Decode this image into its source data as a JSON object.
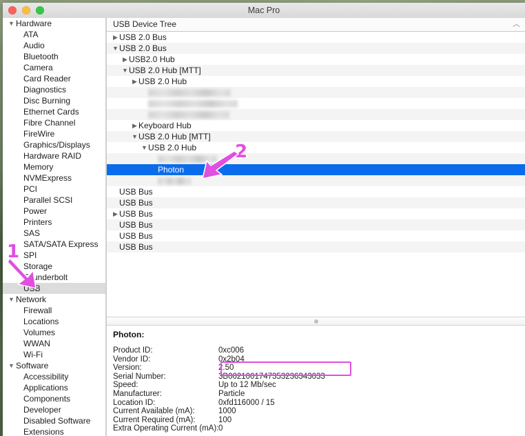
{
  "window": {
    "title": "Mac Pro",
    "traffic_lights": [
      "close-button",
      "minimize-button",
      "maximize-button"
    ]
  },
  "sidebar": {
    "items": [
      {
        "label": "Hardware",
        "level": 0,
        "disclosure": "▼",
        "selected": false
      },
      {
        "label": "ATA",
        "level": 1,
        "disclosure": "",
        "selected": false
      },
      {
        "label": "Audio",
        "level": 1,
        "disclosure": "",
        "selected": false
      },
      {
        "label": "Bluetooth",
        "level": 1,
        "disclosure": "",
        "selected": false
      },
      {
        "label": "Camera",
        "level": 1,
        "disclosure": "",
        "selected": false
      },
      {
        "label": "Card Reader",
        "level": 1,
        "disclosure": "",
        "selected": false
      },
      {
        "label": "Diagnostics",
        "level": 1,
        "disclosure": "",
        "selected": false
      },
      {
        "label": "Disc Burning",
        "level": 1,
        "disclosure": "",
        "selected": false
      },
      {
        "label": "Ethernet Cards",
        "level": 1,
        "disclosure": "",
        "selected": false
      },
      {
        "label": "Fibre Channel",
        "level": 1,
        "disclosure": "",
        "selected": false
      },
      {
        "label": "FireWire",
        "level": 1,
        "disclosure": "",
        "selected": false
      },
      {
        "label": "Graphics/Displays",
        "level": 1,
        "disclosure": "",
        "selected": false
      },
      {
        "label": "Hardware RAID",
        "level": 1,
        "disclosure": "",
        "selected": false
      },
      {
        "label": "Memory",
        "level": 1,
        "disclosure": "",
        "selected": false
      },
      {
        "label": "NVMExpress",
        "level": 1,
        "disclosure": "",
        "selected": false
      },
      {
        "label": "PCI",
        "level": 1,
        "disclosure": "",
        "selected": false
      },
      {
        "label": "Parallel SCSI",
        "level": 1,
        "disclosure": "",
        "selected": false
      },
      {
        "label": "Power",
        "level": 1,
        "disclosure": "",
        "selected": false
      },
      {
        "label": "Printers",
        "level": 1,
        "disclosure": "",
        "selected": false
      },
      {
        "label": "SAS",
        "level": 1,
        "disclosure": "",
        "selected": false
      },
      {
        "label": "SATA/SATA Express",
        "level": 1,
        "disclosure": "",
        "selected": false
      },
      {
        "label": "SPI",
        "level": 1,
        "disclosure": "",
        "selected": false
      },
      {
        "label": "Storage",
        "level": 1,
        "disclosure": "",
        "selected": false
      },
      {
        "label": "Thunderbolt",
        "level": 1,
        "disclosure": "",
        "selected": false
      },
      {
        "label": "USB",
        "level": 1,
        "disclosure": "",
        "selected": true
      },
      {
        "label": "Network",
        "level": 0,
        "disclosure": "▼",
        "selected": false
      },
      {
        "label": "Firewall",
        "level": 1,
        "disclosure": "",
        "selected": false
      },
      {
        "label": "Locations",
        "level": 1,
        "disclosure": "",
        "selected": false
      },
      {
        "label": "Volumes",
        "level": 1,
        "disclosure": "",
        "selected": false
      },
      {
        "label": "WWAN",
        "level": 1,
        "disclosure": "",
        "selected": false
      },
      {
        "label": "Wi-Fi",
        "level": 1,
        "disclosure": "",
        "selected": false
      },
      {
        "label": "Software",
        "level": 0,
        "disclosure": "▼",
        "selected": false
      },
      {
        "label": "Accessibility",
        "level": 1,
        "disclosure": "",
        "selected": false
      },
      {
        "label": "Applications",
        "level": 1,
        "disclosure": "",
        "selected": false
      },
      {
        "label": "Components",
        "level": 1,
        "disclosure": "",
        "selected": false
      },
      {
        "label": "Developer",
        "level": 1,
        "disclosure": "",
        "selected": false
      },
      {
        "label": "Disabled Software",
        "level": 1,
        "disclosure": "",
        "selected": false
      },
      {
        "label": "Extensions",
        "level": 1,
        "disclosure": "",
        "selected": false
      }
    ]
  },
  "tree": {
    "header": "USB Device Tree",
    "collapse_icon": "︿",
    "rows": [
      {
        "label": "USB 2.0 Bus",
        "indent": 0,
        "disclosure": "▶",
        "selected": false,
        "redacted": false
      },
      {
        "label": "USB 2.0 Bus",
        "indent": 0,
        "disclosure": "▼",
        "selected": false,
        "redacted": false
      },
      {
        "label": "USB2.0 Hub",
        "indent": 1,
        "disclosure": "▶",
        "selected": false,
        "redacted": false
      },
      {
        "label": "USB 2.0 Hub [MTT]",
        "indent": 1,
        "disclosure": "▼",
        "selected": false,
        "redacted": false
      },
      {
        "label": "USB 2.0 Hub",
        "indent": 2,
        "disclosure": "▶",
        "selected": false,
        "redacted": false
      },
      {
        "label": "",
        "indent": 3,
        "disclosure": "",
        "selected": false,
        "redacted": true,
        "blur_width": 120
      },
      {
        "label": "",
        "indent": 3,
        "disclosure": "",
        "selected": false,
        "redacted": true,
        "blur_width": 130
      },
      {
        "label": "",
        "indent": 3,
        "disclosure": "",
        "selected": false,
        "redacted": true,
        "blur_width": 118
      },
      {
        "label": "Keyboard Hub",
        "indent": 2,
        "disclosure": "▶",
        "selected": false,
        "redacted": false
      },
      {
        "label": "USB 2.0 Hub [MTT]",
        "indent": 2,
        "disclosure": "▼",
        "selected": false,
        "redacted": false
      },
      {
        "label": "USB 2.0 Hub",
        "indent": 3,
        "disclosure": "▼",
        "selected": false,
        "redacted": false
      },
      {
        "label": "",
        "indent": 4,
        "disclosure": "",
        "selected": false,
        "redacted": true,
        "blur_width": 86
      },
      {
        "label": "Photon",
        "indent": 4,
        "disclosure": "",
        "selected": true,
        "redacted": false
      },
      {
        "label": "",
        "indent": 4,
        "disclosure": "",
        "selected": false,
        "redacted": true,
        "blur_width": 48
      },
      {
        "label": "USB Bus",
        "indent": 0,
        "disclosure": "",
        "selected": false,
        "redacted": false
      },
      {
        "label": "USB Bus",
        "indent": 0,
        "disclosure": "",
        "selected": false,
        "redacted": false
      },
      {
        "label": "USB Bus",
        "indent": 0,
        "disclosure": "▶",
        "selected": false,
        "redacted": false
      },
      {
        "label": "USB Bus",
        "indent": 0,
        "disclosure": "",
        "selected": false,
        "redacted": false
      },
      {
        "label": "USB Bus",
        "indent": 0,
        "disclosure": "",
        "selected": false,
        "redacted": false
      },
      {
        "label": "USB Bus",
        "indent": 0,
        "disclosure": "",
        "selected": false,
        "redacted": false
      }
    ]
  },
  "detail": {
    "title": "Photon:",
    "fields": [
      {
        "label": "Product ID:",
        "value": "0xc006"
      },
      {
        "label": "Vendor ID:",
        "value": "0x2b04"
      },
      {
        "label": "Version:",
        "value": "2.50"
      },
      {
        "label": "Serial Number:",
        "value": "3B0021001747353236343033"
      },
      {
        "label": "Speed:",
        "value": "Up to 12 Mb/sec"
      },
      {
        "label": "Manufacturer:",
        "value": "Particle"
      },
      {
        "label": "Location ID:",
        "value": "0xfd116000 / 15"
      },
      {
        "label": "Current Available (mA):",
        "value": "1000"
      },
      {
        "label": "Current Required (mA):",
        "value": "100"
      },
      {
        "label": "Extra Operating Current (mA):",
        "value": "0"
      }
    ]
  },
  "annotations": {
    "marker_color": "#e14ee1",
    "items": [
      {
        "number": "1",
        "target": "sidebar-item-usb"
      },
      {
        "number": "2",
        "target": "tree-row-photon"
      }
    ],
    "highlight": {
      "field": "Serial Number",
      "color": "#e14ee1"
    }
  }
}
